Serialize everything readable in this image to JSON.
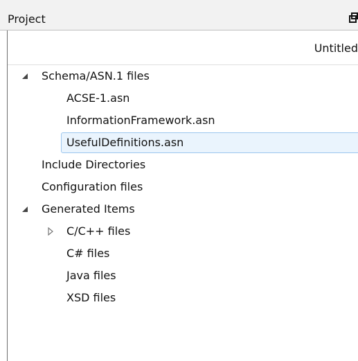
{
  "panel": {
    "title": "Project",
    "column_header": "Untitled"
  },
  "tree": {
    "schema_files": "Schema/ASN.1 files",
    "acse": "ACSE-1.asn",
    "info_framework": "InformationFramework.asn",
    "useful_defs": "UsefulDefinitions.asn",
    "include_dirs": "Include Directories",
    "config_files": "Configuration files",
    "generated_items": "Generated Items",
    "cpp_files": "C/C++ files",
    "csharp_files": "C# files",
    "java_files": "Java files",
    "xsd_files": "XSD files"
  },
  "icons": {
    "expanded": "expanded-triangle-icon",
    "collapsed": "collapsed-triangle-icon",
    "pin": "pin-icon"
  },
  "colors": {
    "selection_fill": "#eaf4fd",
    "selection_border": "#9cc6ee",
    "titlebar": "#f2f2f2"
  }
}
